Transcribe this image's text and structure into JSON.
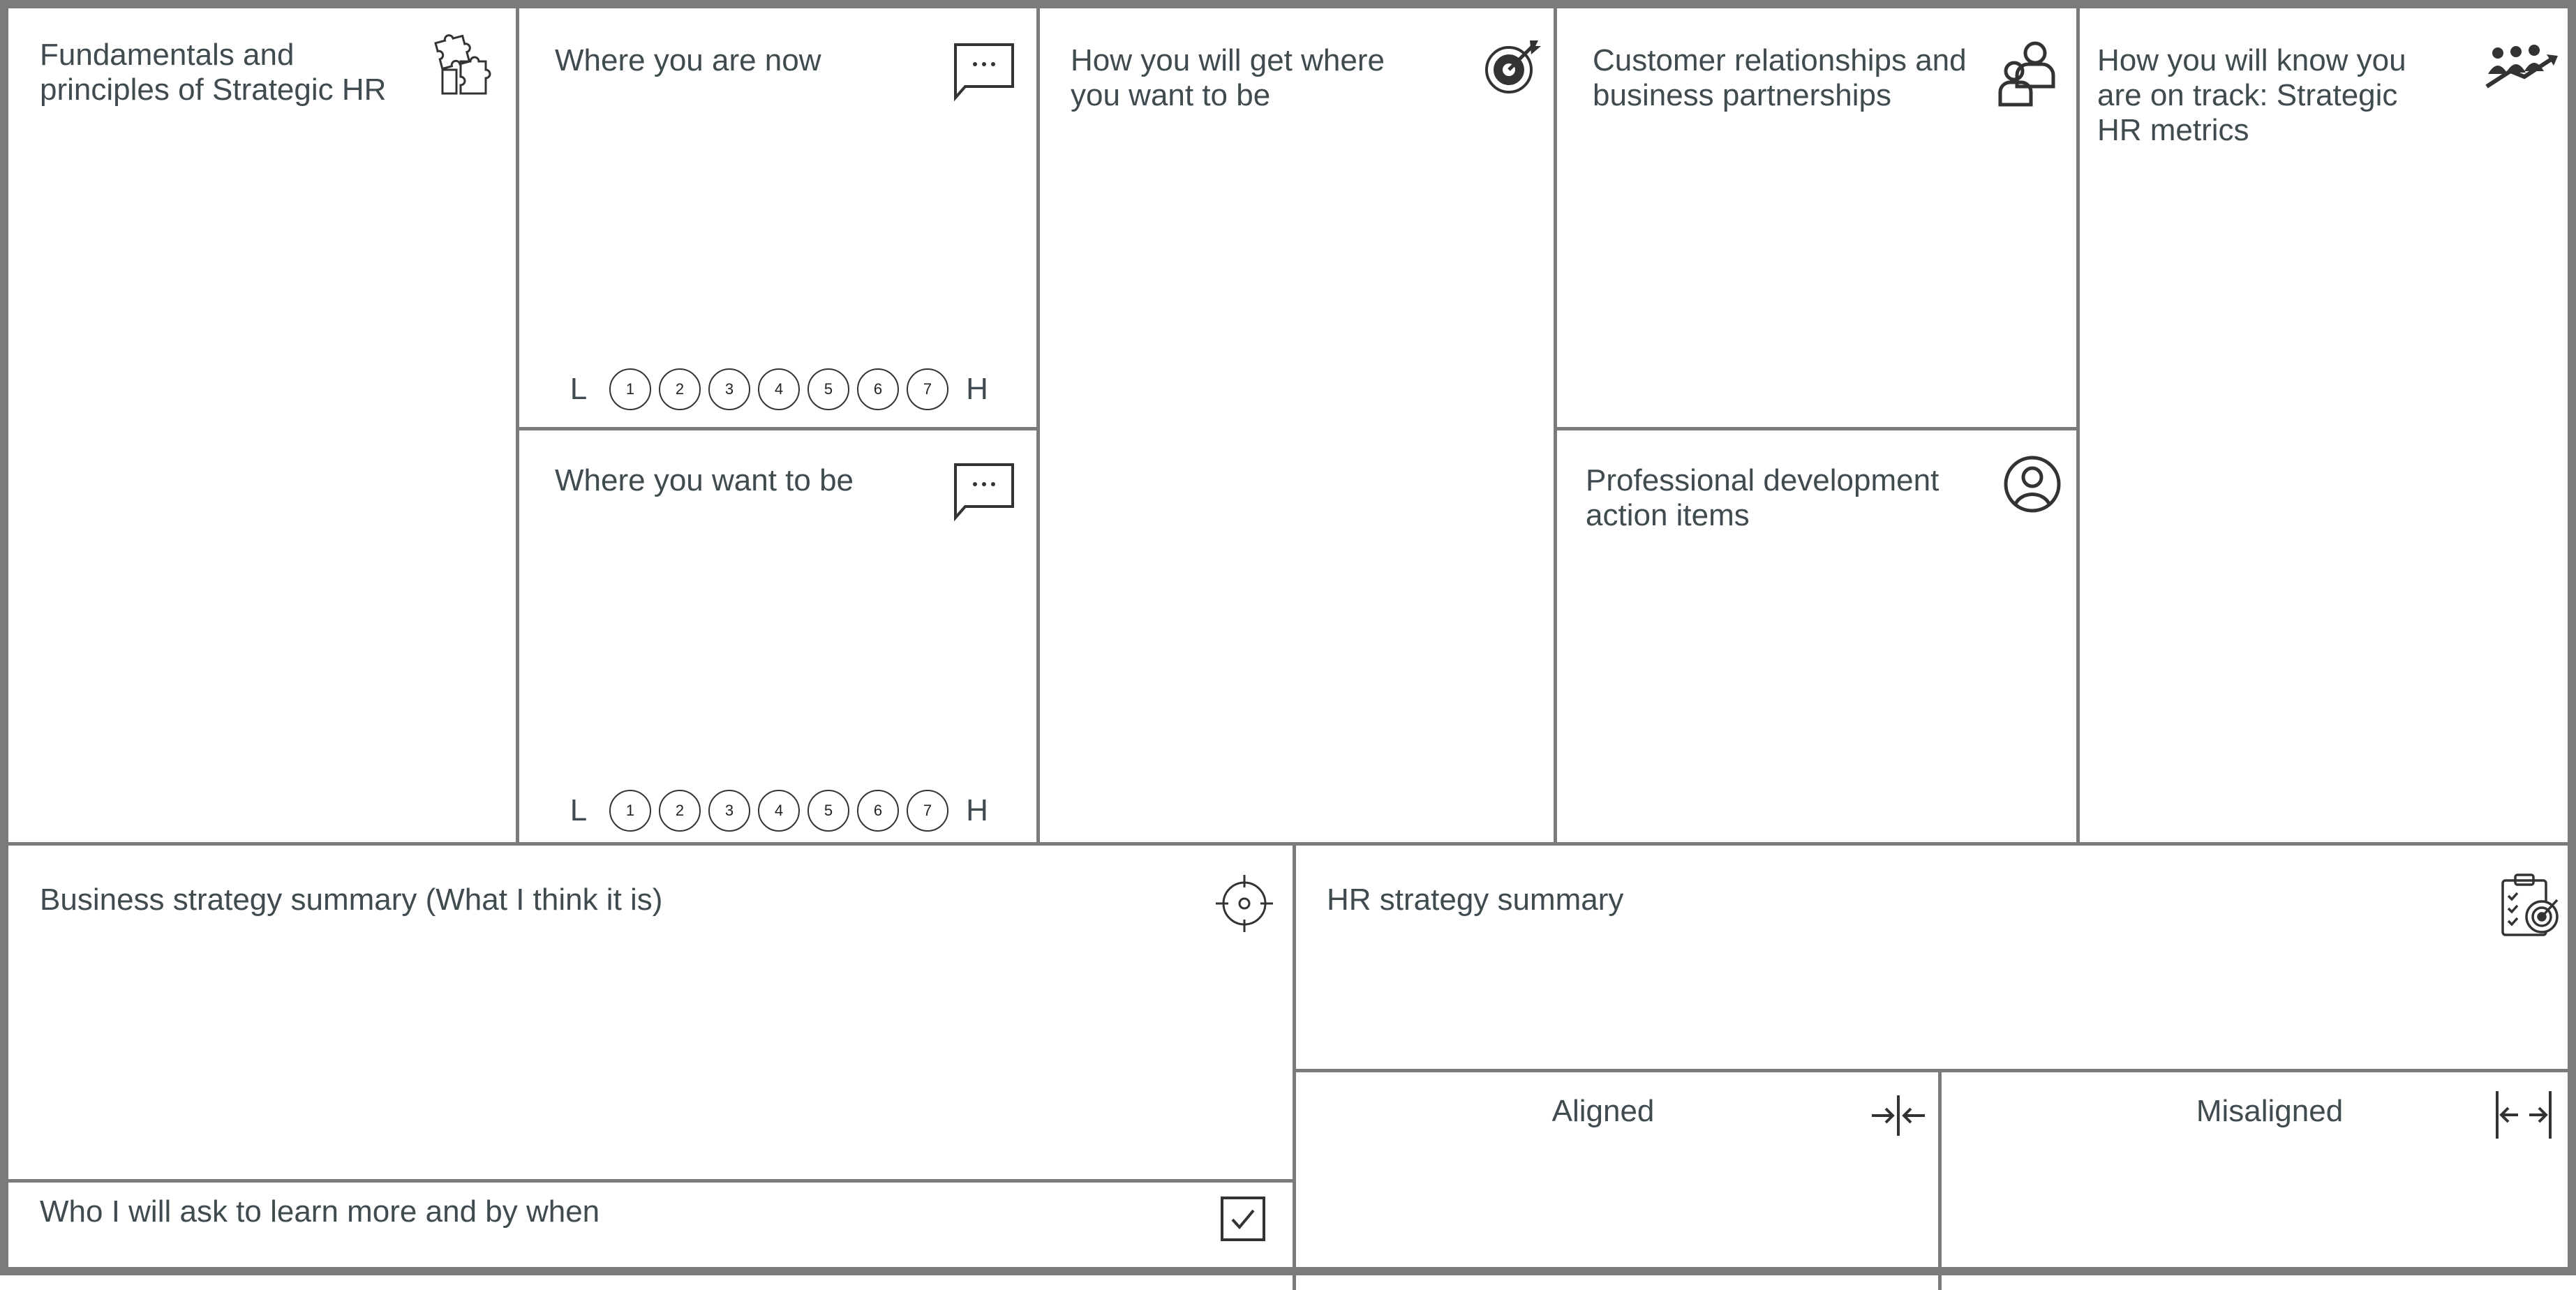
{
  "cells": {
    "fundamentals": "Fundamentals and principles of Strategic HR",
    "where_now": "Where you are now",
    "where_want": "Where you want to be",
    "how_get": "How you will get where you want to be",
    "customer": "Customer relationships and business partnerships",
    "professional": "Professional development action items",
    "how_know": "How you will know you are on track: Strategic HR metrics",
    "business_summary": "Business strategy summary (What I think it is)",
    "hr_summary": "HR strategy summary",
    "who_ask": "Who I will ask to learn more and by when",
    "aligned": "Aligned",
    "misaligned": "Misaligned"
  },
  "scale": {
    "low": "L",
    "high": "H",
    "values": [
      "1",
      "2",
      "3",
      "4",
      "5",
      "6",
      "7"
    ]
  },
  "icons": {
    "fundamentals": "puzzle-icon",
    "where_now": "chat-bubble-icon",
    "where_want": "chat-bubble-icon",
    "how_get": "target-dart-icon",
    "customer": "people-icon",
    "professional": "user-circle-icon",
    "how_know": "team-growth-icon",
    "business_summary": "crosshair-icon",
    "hr_summary": "clipboard-target-icon",
    "who_ask": "checkbox-icon",
    "aligned": "converge-arrows-icon",
    "misaligned": "diverge-arrows-icon"
  },
  "colors": {
    "border": "#7b7b7b",
    "text": "#3f4b4f"
  }
}
